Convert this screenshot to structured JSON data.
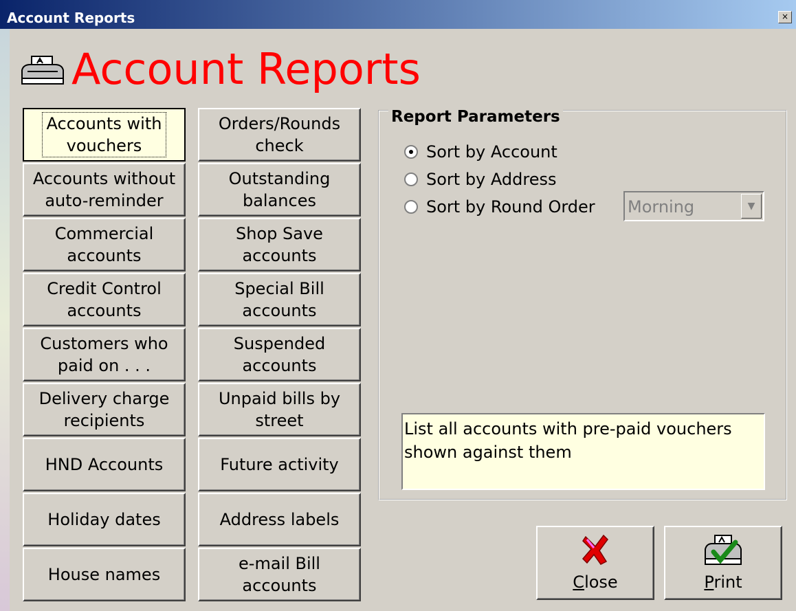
{
  "window": {
    "title": "Account Reports",
    "close_label": "×"
  },
  "heading": "Account Reports",
  "reports": [
    {
      "label": "Accounts with\nvouchers",
      "active": true
    },
    {
      "label": "Accounts without\nauto-reminder"
    },
    {
      "label": "Commercial\naccounts"
    },
    {
      "label": "Credit Control\naccounts"
    },
    {
      "label": "Customers who\npaid on . . ."
    },
    {
      "label": "Delivery charge\nrecipients"
    },
    {
      "label": "HND Accounts"
    },
    {
      "label": "Holiday dates"
    },
    {
      "label": "House names"
    },
    {
      "label": "Orders/Rounds\ncheck"
    },
    {
      "label": "Outstanding\nbalances"
    },
    {
      "label": "Shop Save\naccounts"
    },
    {
      "label": "Special Bill\naccounts"
    },
    {
      "label": "Suspended\naccounts"
    },
    {
      "label": "Unpaid bills by\nstreet"
    },
    {
      "label": "Future activity"
    },
    {
      "label": "Address labels"
    },
    {
      "label": "e-mail Bill\naccounts"
    }
  ],
  "params": {
    "legend": "Report Parameters",
    "options": [
      {
        "label": "Sort by Account",
        "selected": true
      },
      {
        "label": "Sort by Address",
        "selected": false
      },
      {
        "label": "Sort by Round Order",
        "selected": false
      }
    ],
    "round_select": {
      "value": "Morning"
    }
  },
  "description": "List all accounts with pre-paid vouchers shown against them",
  "actions": {
    "close_rest": "lose",
    "close_mnemonic": "C",
    "print_rest": "rint",
    "print_mnemonic": "P"
  }
}
